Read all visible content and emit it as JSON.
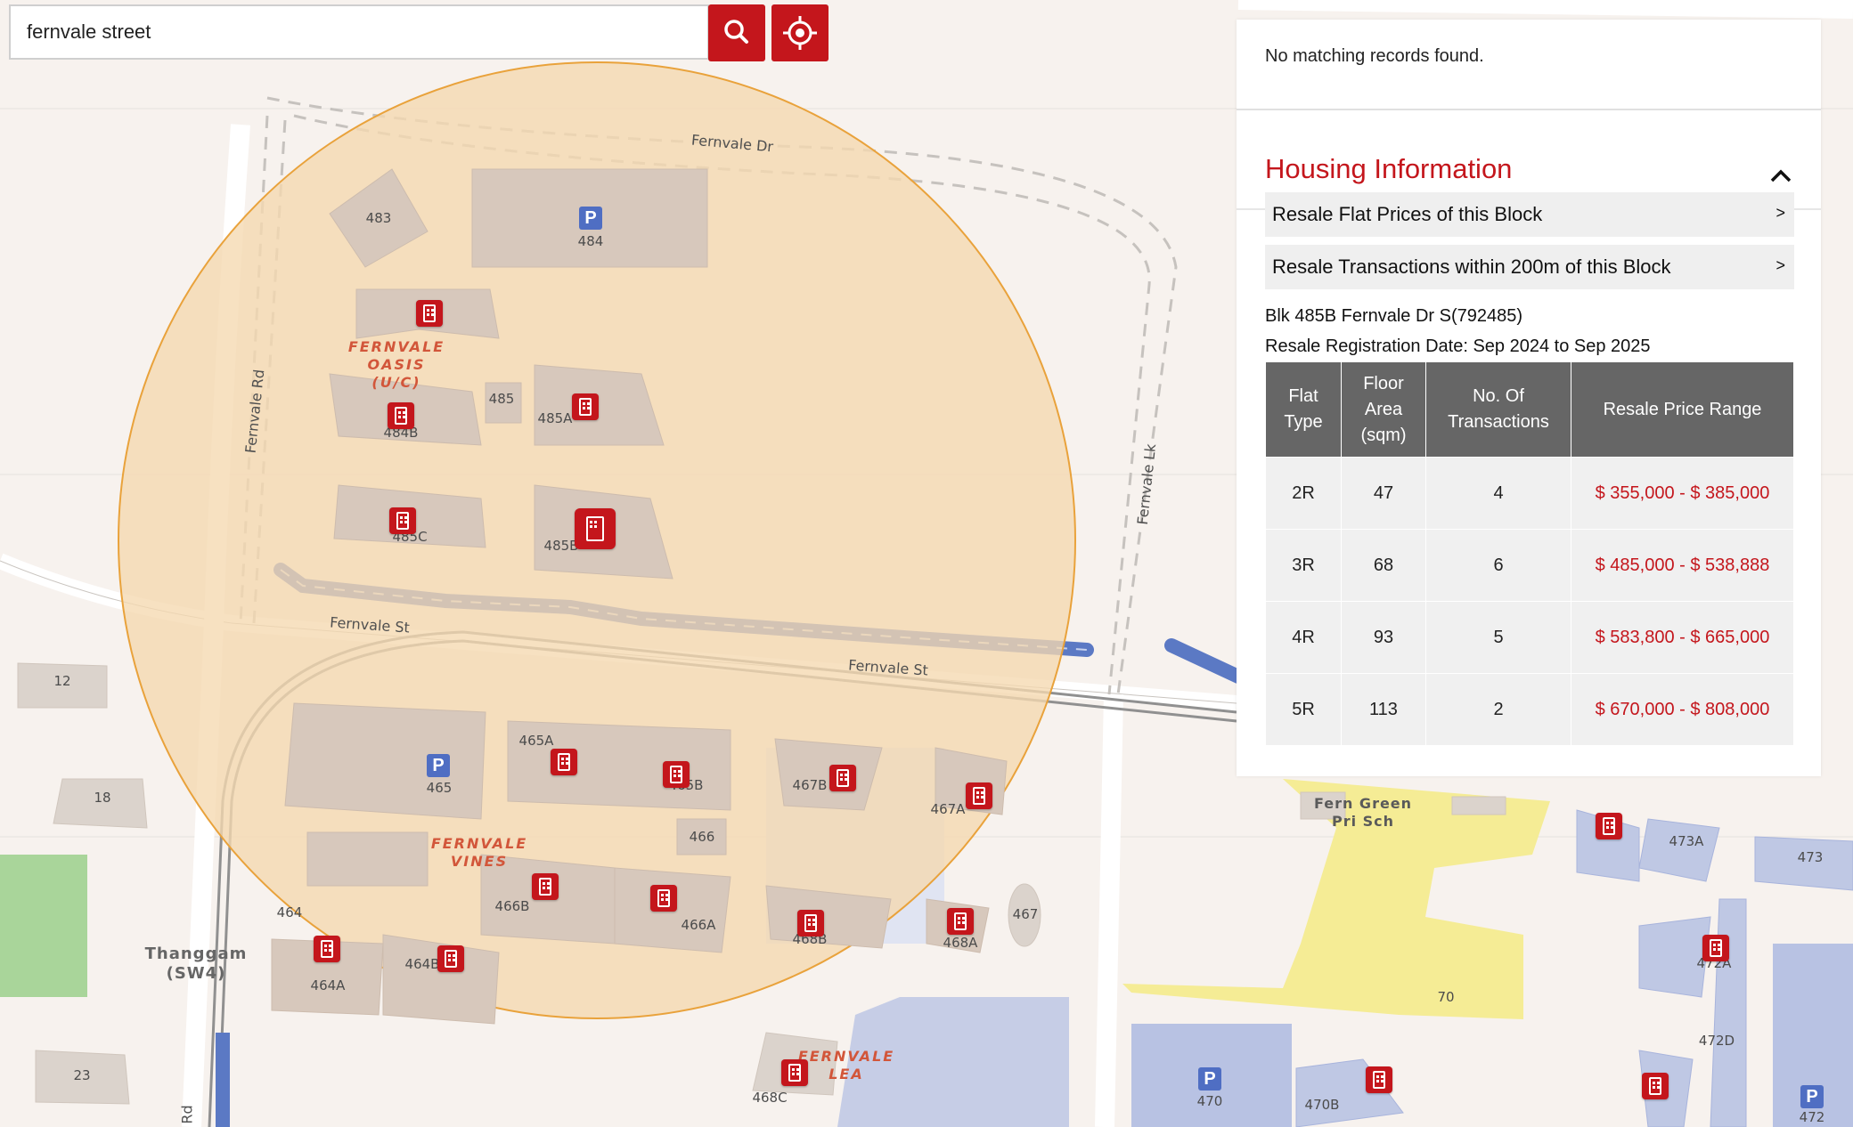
{
  "search": {
    "value": "fernvale street",
    "search_icon": "search-icon",
    "locate_icon": "locate-icon"
  },
  "panel": {
    "no_records": "No matching records found.",
    "housing_title": "Housing Information",
    "collapse_icon": "chevron-up-icon",
    "links": [
      {
        "label": "Resale Flat Prices of this Block",
        "arrow": ">"
      },
      {
        "label": "Resale Transactions within 200m of this Block",
        "arrow": ">"
      }
    ],
    "block_address": "Blk 485B Fernvale Dr S(792485)",
    "resale_date": "Resale Registration Date: Sep 2024 to Sep 2025",
    "table": {
      "headers": [
        "Flat Type",
        "Floor Area (sqm)",
        "No. Of Transactions",
        "Resale Price Range"
      ],
      "rows": [
        [
          "2R",
          "47",
          "4",
          "$ 355,000 - $ 385,000"
        ],
        [
          "3R",
          "68",
          "6",
          "$ 485,000 - $ 538,888"
        ],
        [
          "4R",
          "93",
          "5",
          "$ 583,800 - $ 665,000"
        ],
        [
          "5R",
          "113",
          "2",
          "$ 670,000 - $ 808,000"
        ]
      ]
    }
  },
  "map": {
    "roads": {
      "fernvale_dr": "Fernvale Dr",
      "fernvale_rd": "Fernvale Rd",
      "fernvale_st_w": "Fernvale St",
      "fernvale_st_e": "Fernvale St",
      "fernvale_lk": "Fernvale Lk",
      "rd_bottom": "Rd"
    },
    "estates": {
      "oasis": "FERNVALE\nOASIS\n(U/C)",
      "vines": "FERNVALE\nVINES",
      "lea": "FERNVALE\nLEA"
    },
    "school": "Fern Green\nPri Sch",
    "station": "Thanggam\n(SW4)",
    "blocks": {
      "b483": "483",
      "b484": "484",
      "b484b": "484B",
      "b485": "485",
      "b485a": "485A",
      "b485c": "485C",
      "b485b": "485B",
      "b12": "12",
      "b18": "18",
      "b23": "23",
      "b465": "465",
      "b465a": "465A",
      "b465b": "465B",
      "b466": "466",
      "b466a": "466A",
      "b466b": "466B",
      "b467": "467",
      "b467a": "467A",
      "b467b": "467B",
      "b468a": "468A",
      "b468b": "468B",
      "b468c": "468C",
      "b464": "464",
      "b464a": "464A",
      "b464b": "464B",
      "b470": "470",
      "b470b": "470B",
      "b70": "70",
      "b473a": "473A",
      "b473": "473",
      "b472a": "472A",
      "b472d": "472D",
      "b472": "472"
    },
    "parking_symbol": "P",
    "colors": {
      "radius_fill": "#f5d9b0",
      "radius_stroke": "#e9a23b",
      "accent": "#c4161c",
      "cycle_path": "#5b79c4"
    }
  }
}
